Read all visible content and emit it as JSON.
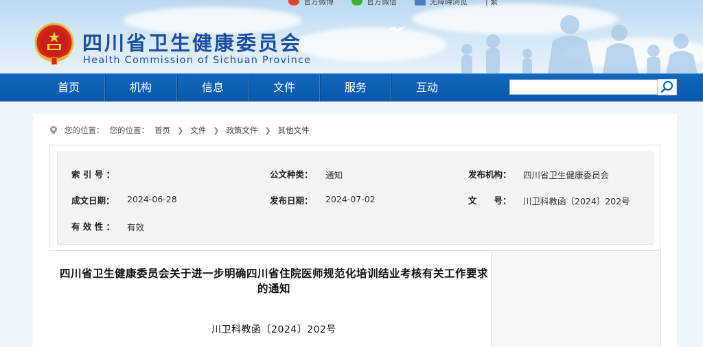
{
  "header": {
    "topbar": [
      {
        "label": "官方微博",
        "icon": "weibo-icon"
      },
      {
        "label": "官方微信",
        "icon": "wechat-icon"
      },
      {
        "label": "无障碍浏览",
        "icon": "accessibility-icon"
      },
      {
        "label": "| 繁",
        "icon": ""
      }
    ],
    "title": "四川省卫生健康委员会",
    "subtitle": "Health Commission of Sichuan Province"
  },
  "nav": {
    "items": [
      "首页",
      "机构",
      "信息",
      "文件",
      "服务",
      "互动"
    ],
    "search_placeholder": "",
    "search_icon": "search-icon"
  },
  "breadcrumb": {
    "prefix": "您的位置：",
    "label": "您的位置：",
    "items": [
      "首页",
      "文件",
      "政策文件",
      "其他文件"
    ]
  },
  "meta": {
    "index_label": "索 引 号 ：",
    "index_value": "",
    "type_label": "公文种类：",
    "type_value": "通知",
    "issuer_label": "发布机构：",
    "issuer_value": "四川省卫生健康委员会",
    "created_label": "成文日期：",
    "created_value": "2024-06-28",
    "published_label": "发布日期：",
    "published_value": "2024-07-02",
    "docno_label": "文　　号：",
    "docno_value": "川卫科教函〔2024〕202号",
    "validity_label": "有 效 性 ：",
    "validity_value": "有效"
  },
  "document": {
    "title": "四川省卫生健康委员会关于进一步明确四川省住院医师规范化培训结业考核有关工作要求的通知",
    "number": "川卫科教函〔2024〕202号"
  },
  "colors": {
    "brand_blue": "#1e4f9a",
    "nav_blue": "#0a5fb4"
  }
}
